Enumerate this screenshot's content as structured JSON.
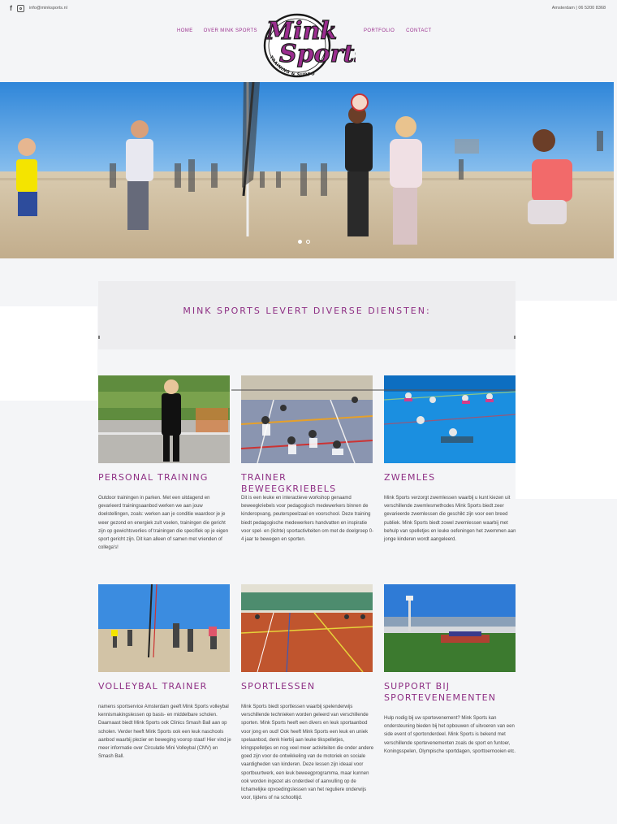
{
  "topbar": {
    "social": [
      "facebook-icon",
      "instagram-icon"
    ],
    "email": "info@minksports.nl",
    "location": "Amsterdam | 06 5200 8368"
  },
  "nav": {
    "home": "HOME",
    "over": "OVER MINK SPORTS",
    "portfolio": "PORTFOLIO",
    "contact": "CONTACT"
  },
  "logo": {
    "line1": "Mink",
    "line2": "Sports",
    "tagline": "TRAINING & SUPPORT"
  },
  "hero": {
    "slides": 2,
    "active_slide": 1
  },
  "services": {
    "heading": "MINK SPORTS LEVERT DIVERSE DIENSTEN:"
  },
  "cards": [
    {
      "title": "PERSONAL TRAINING",
      "text": "Outdoor trainingen in parken. Met een uitdagend en gevarieerd trainingsaanbod werken we aan jouw doelstellingen, zoals: werken aan je conditie waardoor je je weer gezond en energiek zult voelen, trainingen die gericht zijn op gewichtsverlies of trainingen die specifiek op je eigen sport gericht zijn. Dit kan alleen of samen met vrienden of collega's!"
    },
    {
      "title": "TRAINER BEWEEGKRIEBELS",
      "text": "Dit is een leuke en interactieve workshop genaamd beweegkriebels voor pedagogisch medewerkers binnen de kinderopvang, peuterspeelzaal en voorschool. Deze training biedt pedagogische medewerkers handvatten en inspiratie voor spel- en (lichte) sportactiviteiten om met de doelgroep 0-4 jaar te bewegen en sporten."
    },
    {
      "title": "ZWEMLES",
      "text": "Mink Sports verzorgt zwemlessen waarbij u kunt kiezen uit verschillende zwemlesmethodes Mink Sports biedt zeer gevarieerde zwemlessen die geschikt zijn voor een breed publiek. Mink Sports biedt zowel zwemlessen waarbij met behulp van spelletjes en leuke oefeningen het zwemmen aan jonge kinderen wordt aangeleerd."
    },
    {
      "title": "VOLLEYBAL TRAINER",
      "text": "namens sportservice Amsterdam geeft Mink Sports volleybal kennismakingslessen op basis- en middelbare scholen. Daarnaast biedt Mink Sports ook Clinics Smash Ball aan op scholen. Verder heeft Mink Sports ook een leuk naschools aanbod waarbij plezier en beweging voorop staat! Hier vind je meer informatie over Circulatie Mini Volleybal (CMV) en Smash Ball."
    },
    {
      "title": "SPORTLESSEN",
      "text": "Mink Sports biedt sportlessen waarbij spelenderwijs verschillende technieken worden geleerd van verschillende sporten. Mink Sports heeft een divers en leuk sportaanbod voor jong en oud! Ook heeft Mink Sports een leuk en uniek spelaanbod, denk hierbij aan leuke tikspelletjes, kringspelletjes en nog veel meer activiteiten die onder andere goed zijn voor de ontwikkeling van de motoriek en sociale vaardigheden van kinderen. Deze lessen zijn ideaal voor sportbuurtwerk, een leuk beweegprogramma, maar kunnen ook worden ingezet als onderdeel of aanvulling op de lichamelijke opvoedingslessen van het reguliere onderwijs voor, tijdens of na schooltijd."
    },
    {
      "title": "SUPPORT BIJ SPORTEVENEMENTEN",
      "text": "Hulp nodig bij uw sportevenement? Mink Sports kan ondersteuning bieden bij het opbouwen of uitvoeren van een side event of sportonderdeel. Mink Sports is bekend met verschillende sportevenementen zoals de sport en funtoer, Koningsspelen, Olympische sportdagen, sporttoernooien etc."
    }
  ]
}
